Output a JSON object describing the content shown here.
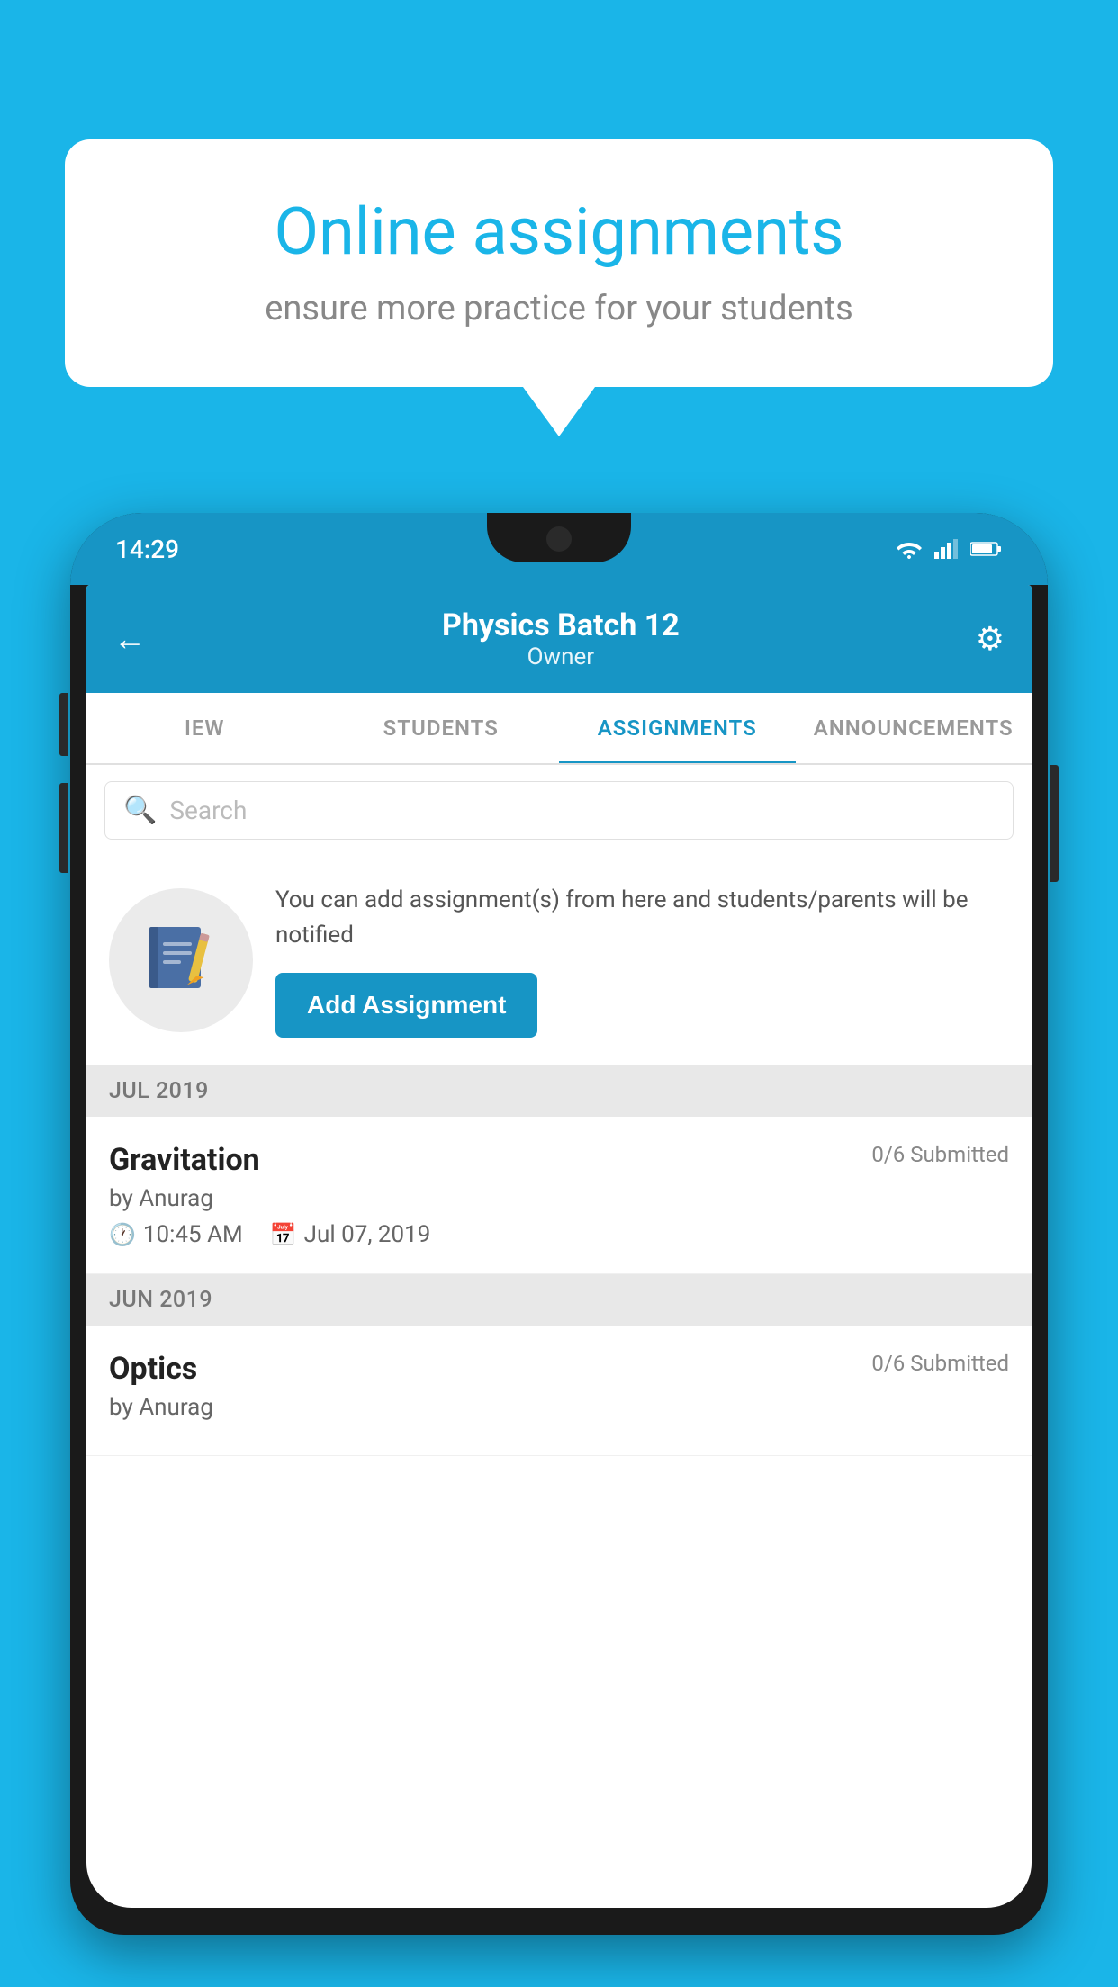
{
  "background_color": "#1ab5e8",
  "speech_bubble": {
    "title": "Online assignments",
    "subtitle": "ensure more practice for your students"
  },
  "phone": {
    "status_bar": {
      "time": "14:29"
    },
    "header": {
      "title": "Physics Batch 12",
      "subtitle": "Owner",
      "back_label": "←",
      "gear_label": "⚙"
    },
    "tabs": [
      {
        "label": "IEW",
        "active": false
      },
      {
        "label": "STUDENTS",
        "active": false
      },
      {
        "label": "ASSIGNMENTS",
        "active": true
      },
      {
        "label": "ANNOUNCEMENTS",
        "active": false
      }
    ],
    "search": {
      "placeholder": "Search"
    },
    "promo": {
      "text": "You can add assignment(s) from here and students/parents will be notified",
      "button_label": "Add Assignment"
    },
    "sections": [
      {
        "month": "JUL 2019",
        "assignments": [
          {
            "title": "Gravitation",
            "submitted": "0/6 Submitted",
            "by": "by Anurag",
            "time": "10:45 AM",
            "date": "Jul 07, 2019"
          }
        ]
      },
      {
        "month": "JUN 2019",
        "assignments": [
          {
            "title": "Optics",
            "submitted": "0/6 Submitted",
            "by": "by Anurag",
            "time": "",
            "date": ""
          }
        ]
      }
    ]
  }
}
